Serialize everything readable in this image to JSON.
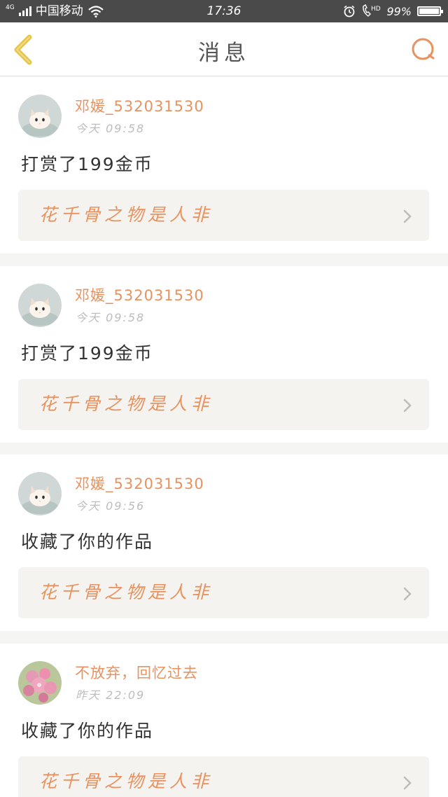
{
  "status_bar": {
    "network": "4G",
    "carrier": "中国移动",
    "time": "17:36",
    "battery": "99%",
    "battery_level": 0.99,
    "icons": [
      "signal-icon",
      "wifi-icon",
      "alarm-icon",
      "call-hd-icon",
      "battery-icon"
    ]
  },
  "header": {
    "title": "消息",
    "back_icon": "chevron-left-icon",
    "search_icon": "search-icon"
  },
  "colors": {
    "accent": "#e8925f",
    "back_icon": "#e6c64a",
    "background": "#f5f5f3",
    "card_link_bg": "#f4f3ef"
  },
  "messages": [
    {
      "username": "邓媛_532031530",
      "time": "今天 09:58",
      "action": "打赏了199金币",
      "work_title": "花千骨之物是人非",
      "avatar": "cat-avatar"
    },
    {
      "username": "邓媛_532031530",
      "time": "今天 09:58",
      "action": "打赏了199金币",
      "work_title": "花千骨之物是人非",
      "avatar": "cat-avatar"
    },
    {
      "username": "邓媛_532031530",
      "time": "今天 09:56",
      "action": "收藏了你的作品",
      "work_title": "花千骨之物是人非",
      "avatar": "cat-avatar"
    },
    {
      "username": "不放弃，回忆过去",
      "time": "昨天 22:09",
      "action": "收藏了你的作品",
      "work_title": "花千骨之物是人非",
      "avatar": "flower-avatar"
    }
  ]
}
